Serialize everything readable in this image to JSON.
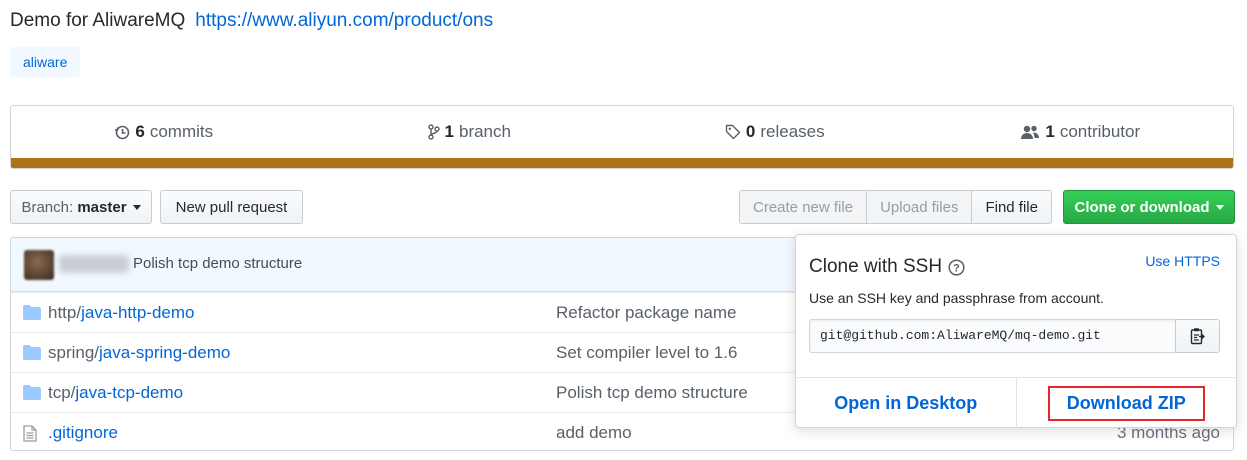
{
  "repo": {
    "description": "Demo for AliwareMQ",
    "homepage": "https://www.aliyun.com/product/ons",
    "topics": [
      "aliware"
    ]
  },
  "summary": {
    "commits_count": "6",
    "commits_label": "commits",
    "branches_count": "1",
    "branches_label": "branch",
    "releases_count": "0",
    "releases_label": "releases",
    "contributors_count": "1",
    "contributors_label": "contributor",
    "language_color": "#b07219"
  },
  "toolbar": {
    "branch_prefix": "Branch:",
    "branch_name": "master",
    "new_pull_request": "New pull request",
    "create_new_file": "Create new file",
    "upload_files": "Upload files",
    "find_file": "Find file",
    "clone_or_download": "Clone or download"
  },
  "latest_commit": {
    "message": "Polish tcp demo structure"
  },
  "files": [
    {
      "prefix": "http/",
      "name": "java-http-demo",
      "type": "folder",
      "message": "Refactor package name",
      "age": ""
    },
    {
      "prefix": "spring/",
      "name": "java-spring-demo",
      "type": "folder",
      "message": "Set compiler level to 1.6",
      "age": ""
    },
    {
      "prefix": "tcp/",
      "name": "java-tcp-demo",
      "type": "folder",
      "message": "Polish tcp demo structure",
      "age": ""
    },
    {
      "prefix": "",
      "name": ".gitignore",
      "type": "file",
      "message": "add demo",
      "age": "3 months ago"
    }
  ],
  "clone_dropdown": {
    "title": "Clone with SSH",
    "switch_link": "Use HTTPS",
    "help_text": "Use an SSH key and passphrase from account.",
    "url": "git@github.com:AliwareMQ/mq-demo.git",
    "open_desktop": "Open in Desktop",
    "download_zip": "Download ZIP"
  },
  "colors": {
    "accent": "#0366d6",
    "primary_button": "#28a745",
    "highlight_box": "#e5242b"
  }
}
